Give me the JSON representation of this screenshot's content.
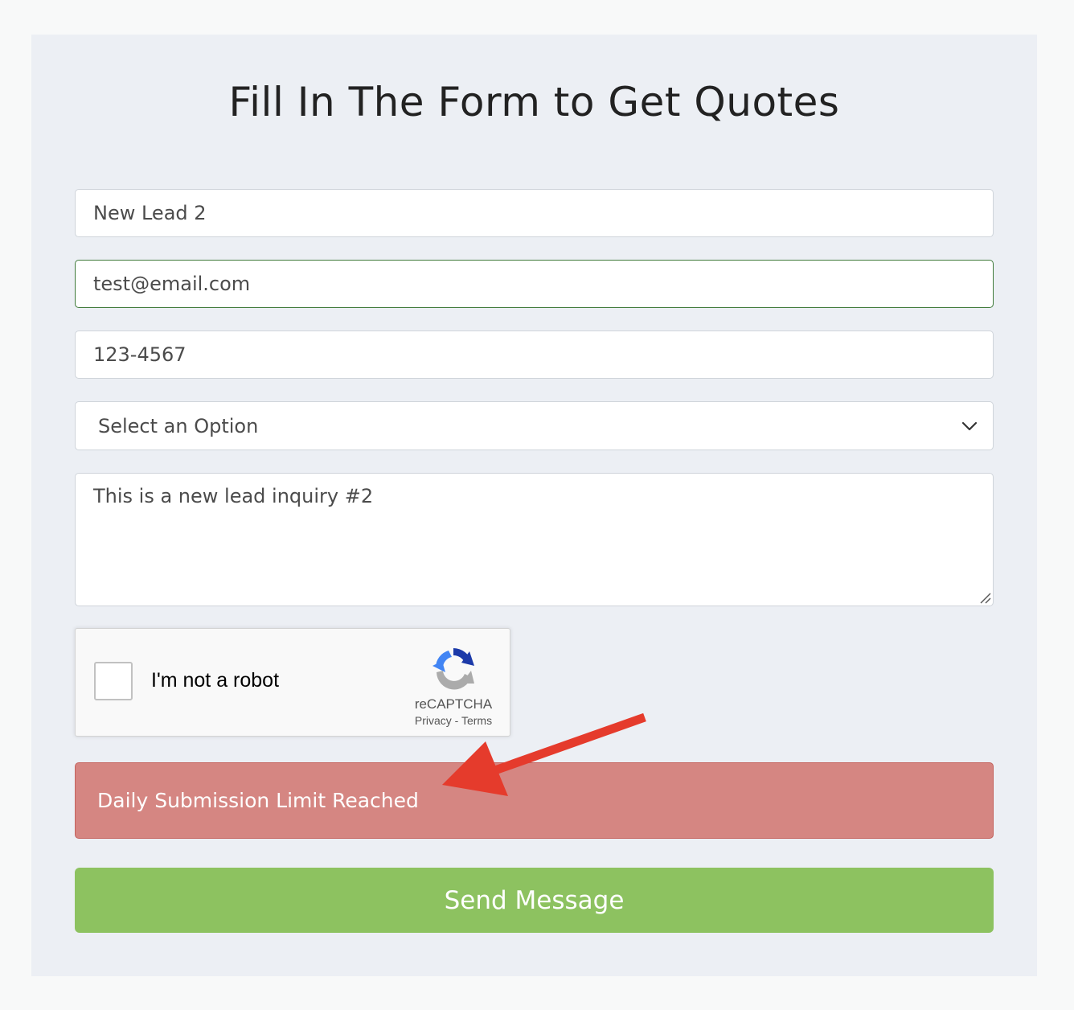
{
  "form": {
    "title": "Fill In The Form to Get Quotes",
    "name_value": "New Lead 2",
    "email_value": "test@email.com",
    "phone_value": "123-4567",
    "select_value": "Select an Option",
    "message_value": "This is a new lead inquiry #2",
    "submit_label": "Send Message"
  },
  "captcha": {
    "label": "I'm not a robot",
    "brand": "reCAPTCHA",
    "privacy": "Privacy",
    "separator": " - ",
    "terms": "Terms"
  },
  "alert": {
    "message": "Daily Submission Limit Reached"
  },
  "colors": {
    "panel_bg": "#eceff4",
    "error_bg": "#d58682",
    "submit_bg": "#8dc260",
    "arrow": "#e53b2c",
    "focus_border": "#3f7a3a"
  },
  "icons": {
    "select": "chevron-down-icon",
    "textarea": "resize-grip-icon",
    "captcha": "recaptcha-logo-icon",
    "annotation": "red-arrow-icon"
  }
}
